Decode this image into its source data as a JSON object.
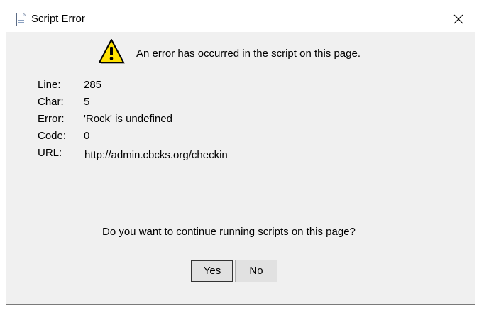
{
  "window": {
    "title": "Script Error"
  },
  "message": "An error has occurred in the script on this page.",
  "details": [
    {
      "label": "Line:",
      "value": "285"
    },
    {
      "label": "Char:",
      "value": "5"
    },
    {
      "label": "Error:",
      "value": "'Rock' is undefined"
    },
    {
      "label": "Code:",
      "value": "0"
    },
    {
      "label": "URL:",
      "value": "http://admin.cbcks.org/checkin"
    }
  ],
  "question": "Do you want to continue running scripts on this page?",
  "buttons": {
    "yes": {
      "accel": "Y",
      "rest": "es"
    },
    "no": {
      "accel": "N",
      "rest": "o"
    }
  },
  "icons": {
    "title": "document-icon",
    "warning": "warning-icon",
    "close": "close-icon"
  },
  "colors": {
    "warning_fill": "#ffe100",
    "dialog_bg": "#f0f0f0"
  }
}
